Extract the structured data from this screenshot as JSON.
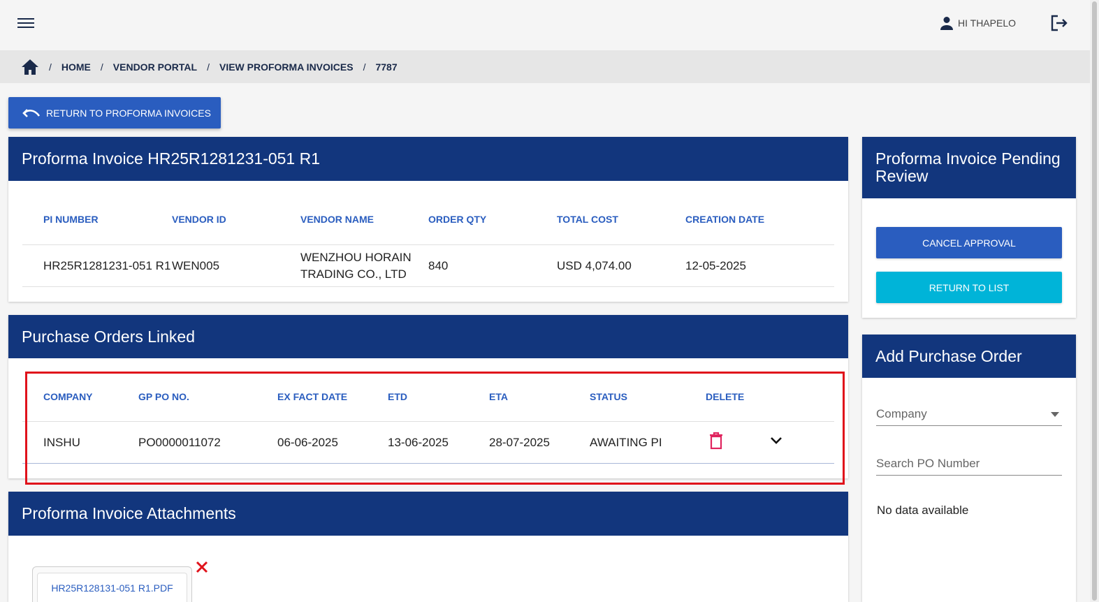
{
  "header": {
    "greeting": "HI THAPELO"
  },
  "breadcrumb": {
    "items": [
      "HOME",
      "VENDOR PORTAL",
      "VIEW PROFORMA INVOICES",
      "7787"
    ]
  },
  "return_button": {
    "label": "RETURN TO PROFORMA INVOICES"
  },
  "invoice": {
    "title": "Proforma Invoice HR25R1281231-051 R1",
    "columns": [
      "PI NUMBER",
      "VENDOR ID",
      "VENDOR NAME",
      "ORDER QTY",
      "TOTAL COST",
      "CREATION DATE"
    ],
    "row": {
      "pi_number": "HR25R1281231-051 R1",
      "vendor_id": "WEN005",
      "vendor_name_line1": "WENZHOU HORAIN",
      "vendor_name_line2": "TRADING CO., LTD",
      "order_qty": "840",
      "total_cost": "USD 4,074.00",
      "creation_date": "12-05-2025"
    }
  },
  "purchase_orders": {
    "title": "Purchase Orders Linked",
    "columns": [
      "COMPANY",
      "GP PO NO.",
      "EX FACT DATE",
      "ETD",
      "ETA",
      "STATUS",
      "DELETE"
    ],
    "rows": [
      {
        "company": "INSHU",
        "po_no": "PO0000011072",
        "ex_fact_date": "06-06-2025",
        "etd": "13-06-2025",
        "eta": "28-07-2025",
        "status": "AWAITING PI"
      }
    ]
  },
  "attachments": {
    "title": "Proforma Invoice Attachments",
    "files": [
      "HR25R128131-051 R1.PDF"
    ]
  },
  "review": {
    "title": "Proforma Invoice Pending Review",
    "cancel_label": "CANCEL APPROVAL",
    "return_label": "RETURN TO LIST"
  },
  "add_po": {
    "title": "Add Purchase Order",
    "company_placeholder": "Company",
    "search_placeholder": "Search PO Number",
    "empty_text": "No data available"
  },
  "colors": {
    "header_blue": "#12367d",
    "primary_button": "#2a5dbf",
    "cyan_button": "#00b4d8",
    "delete_icon": "#e0245e",
    "highlight": "#e0121b"
  },
  "icons": [
    "menu-icon",
    "user-icon",
    "logout-icon",
    "home-icon",
    "undo-icon",
    "trash-icon",
    "chevron-down-icon",
    "caret-down-icon",
    "close-icon"
  ]
}
